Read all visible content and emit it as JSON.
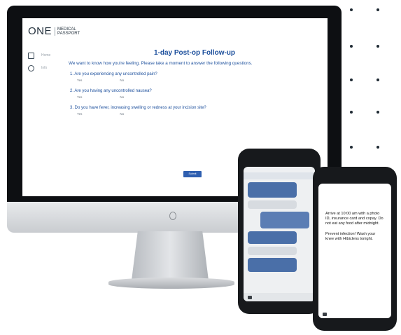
{
  "logo": {
    "name": "ONE",
    "sub_line1": "MEDICAL",
    "sub_line2": "PASSPORT"
  },
  "nav": [
    {
      "label": "Home"
    },
    {
      "label": "Info"
    }
  ],
  "form": {
    "title": "1-day Post-op Follow-up",
    "intro": "We want to know how you're feeling. Please take a moment to answer the following questions.",
    "questions": [
      {
        "text": "1. Are you experiencing any uncontrolled pain?",
        "options": [
          "Yes",
          "No"
        ]
      },
      {
        "text": "2. Are you having any uncontrolled nausea?",
        "options": [
          "Yes",
          "No"
        ]
      },
      {
        "text": "3. Do you have fever, increasing swelling or redness at your incision site?",
        "options": [
          "Yes",
          "No"
        ]
      }
    ],
    "submit_label": "Submit"
  },
  "phone2": {
    "message1": "Arrive at 10:00 am with a photo ID, insurance card and copay. Do not eat any food after midnight.",
    "message2": "Prevent infection! Wash your knee with Hibiclens tonight."
  },
  "colors": {
    "accent_blue": "#1c4f9c",
    "button_blue": "#2f5fb0",
    "green": "#38b54a"
  }
}
